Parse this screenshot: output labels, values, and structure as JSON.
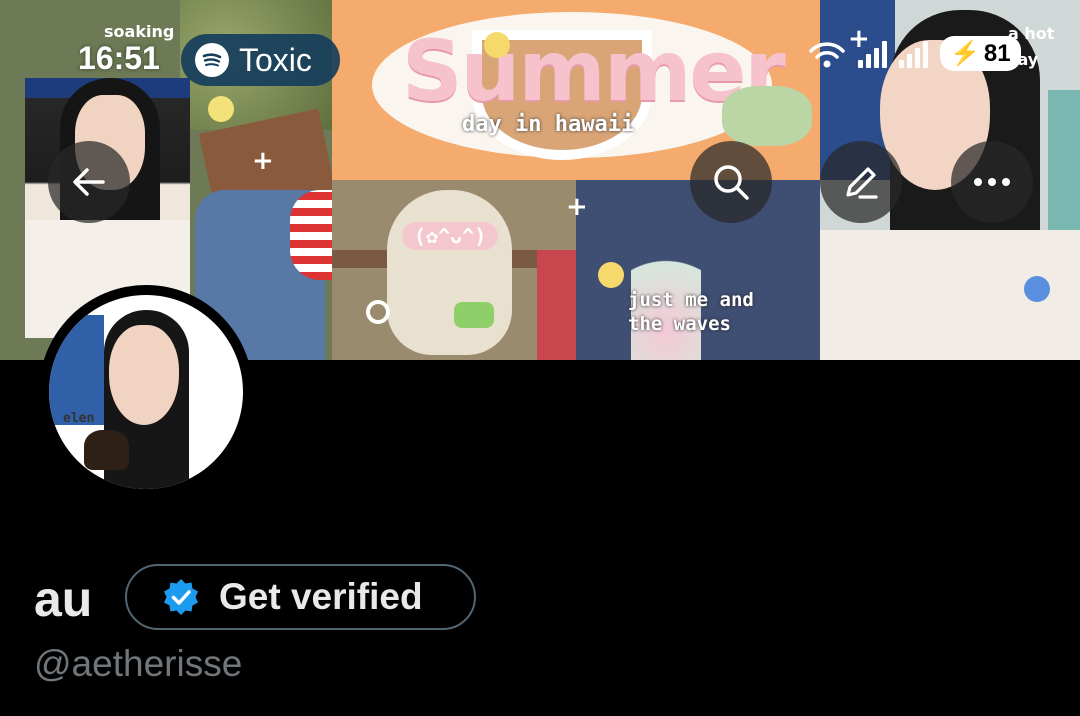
{
  "status_bar": {
    "time": "16:51",
    "battery": "81"
  },
  "now_playing": {
    "label": "Toxic",
    "icon": "spotify-icon"
  },
  "nav": {
    "back_icon": "arrow-left-icon",
    "search_icon": "search-icon",
    "edit_icon": "edit-icon",
    "more_icon": "more-horizontal-icon"
  },
  "banner": {
    "title": "Summer",
    "subtitle": "day in hawaii",
    "kaomoji": "(✿^ᴗ^)",
    "caption_line1": "just me and",
    "caption_line2": "the waves",
    "left_text": "soaking",
    "right_text_1": "a hot",
    "right_text_2": "day",
    "avatar_tag": "elen"
  },
  "profile": {
    "display_name": "au",
    "verify_label": "Get verified",
    "handle": "@aetherisse"
  },
  "colors": {
    "background": "#000000",
    "name": "#e7e9ea",
    "handle": "#71767b",
    "verified_badge": "#1d9bf0",
    "pill": "#163e5c"
  }
}
